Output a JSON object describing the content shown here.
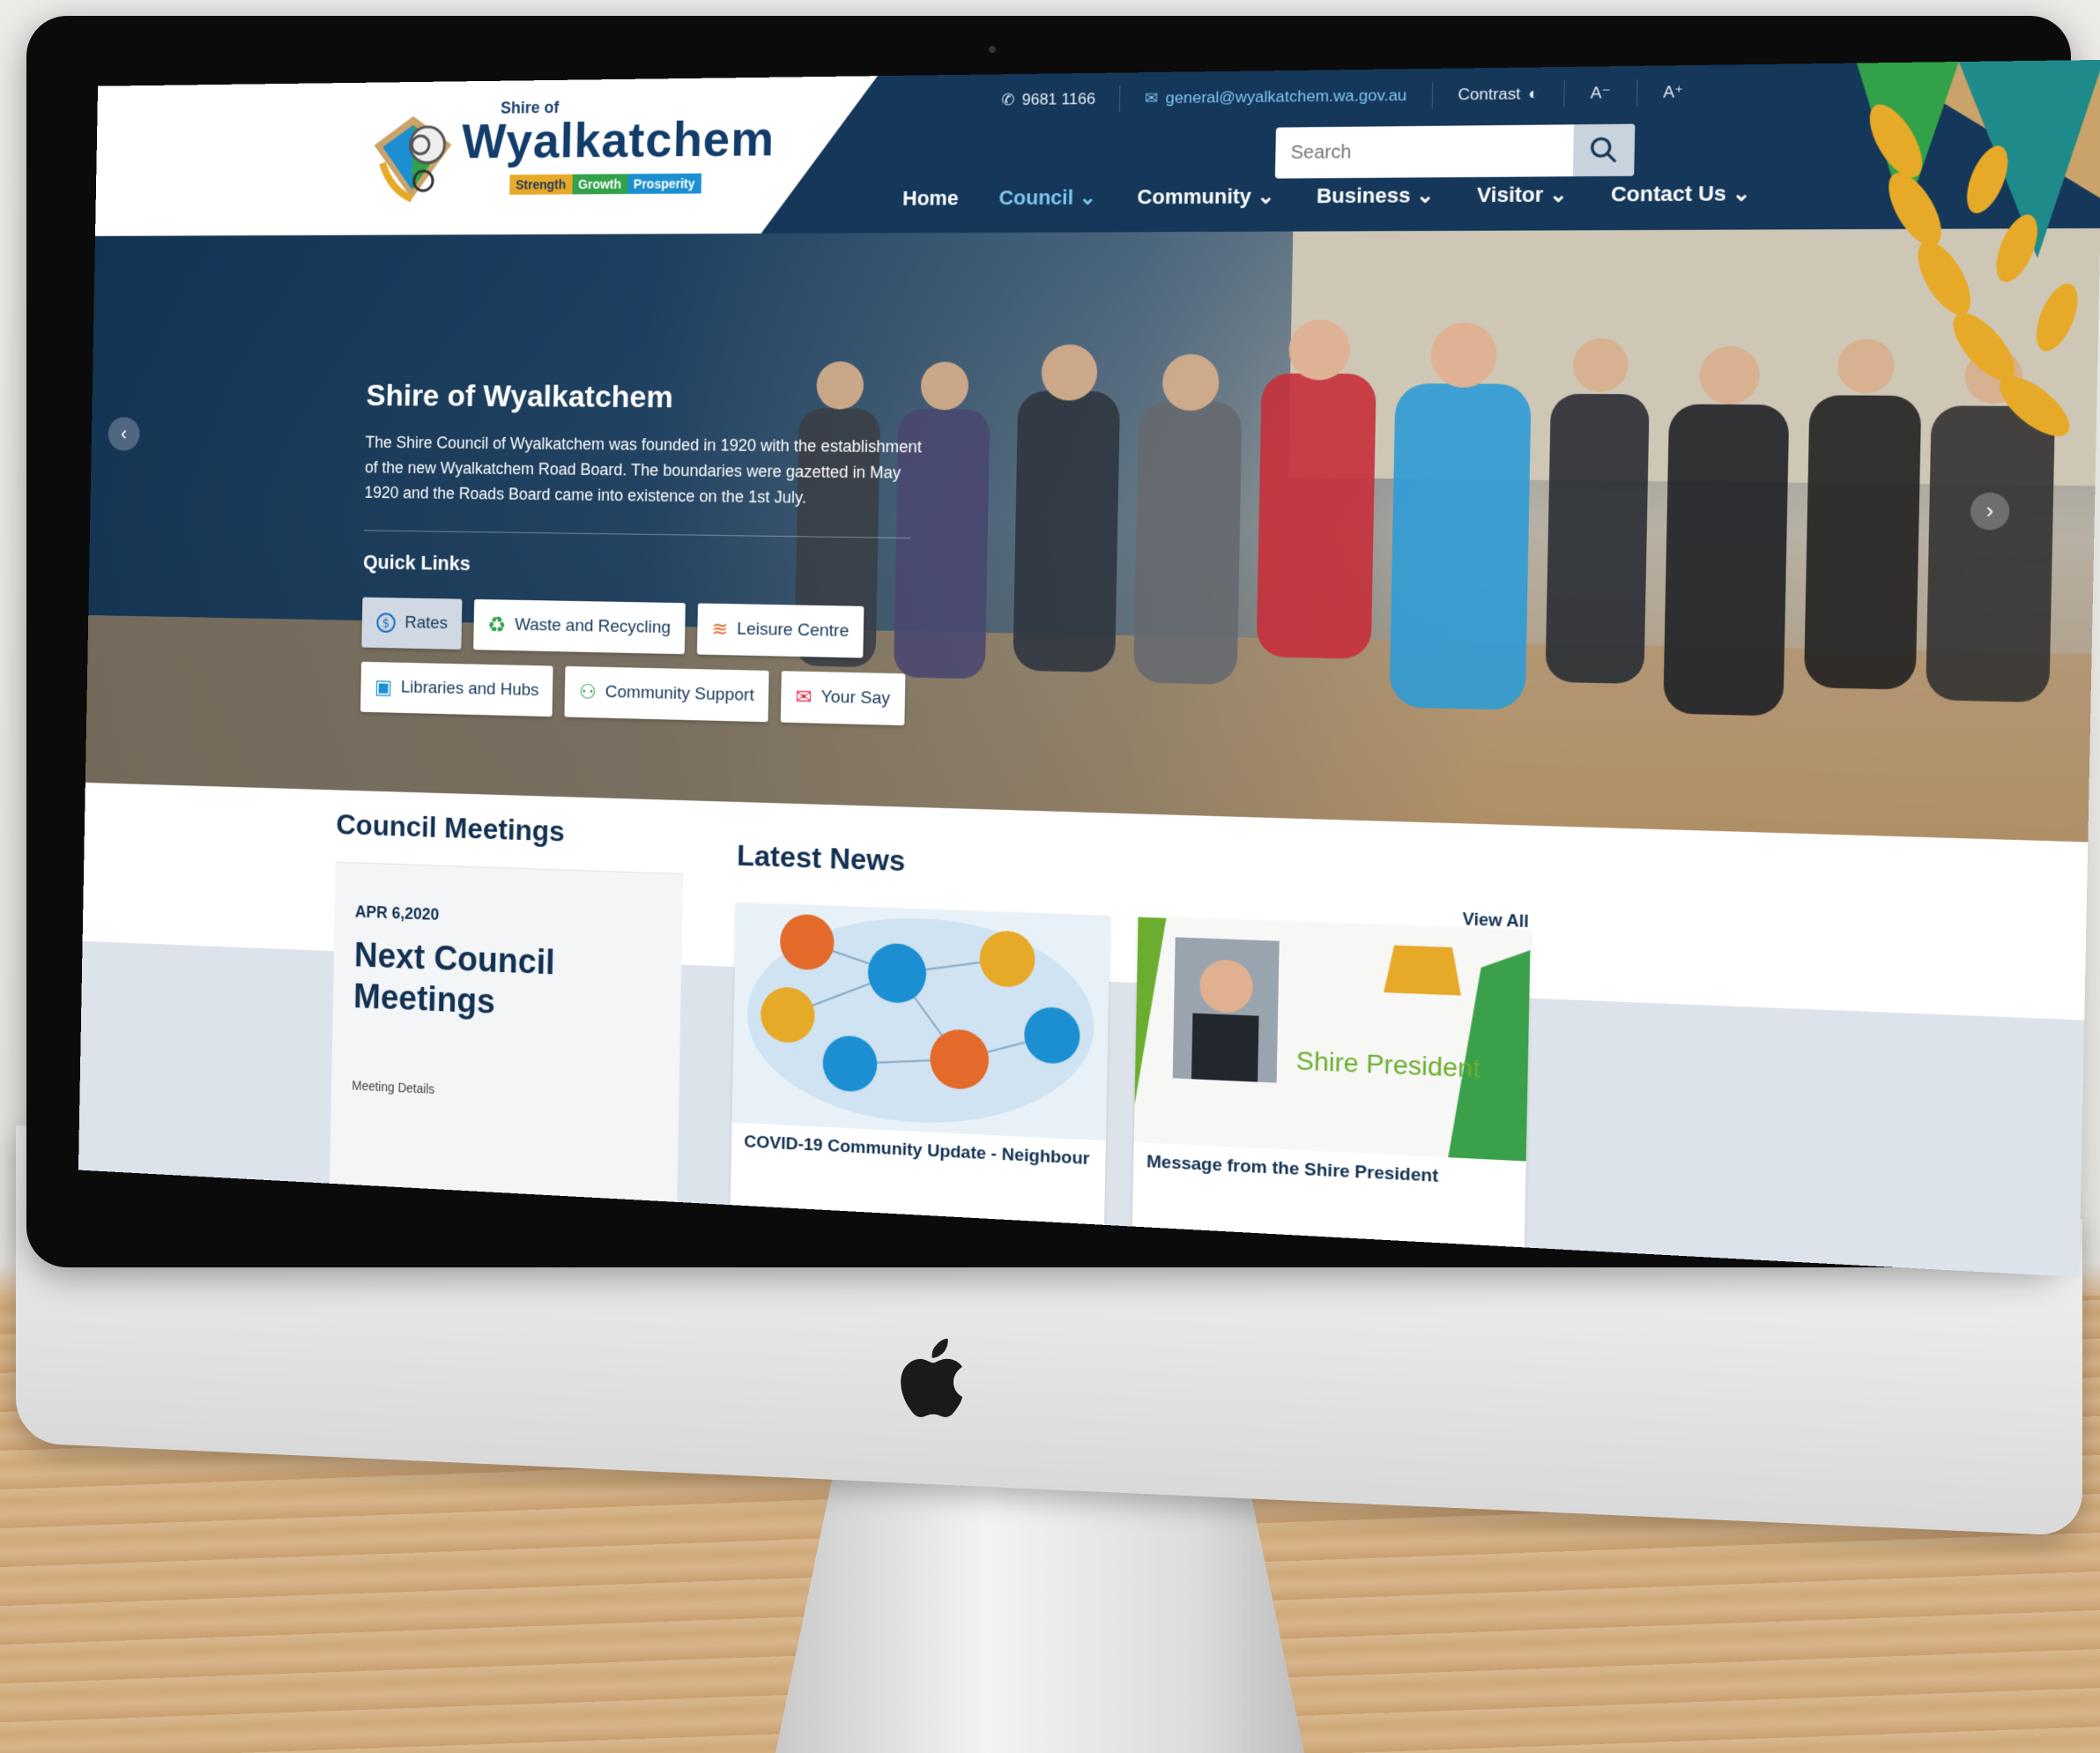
{
  "site": {
    "logo_small": "Shire of",
    "logo_name": "Wyalkatchem",
    "tagline": [
      "Strength",
      "Growth",
      "Prosperity"
    ]
  },
  "topbar": {
    "phone": "9681 1166",
    "email": "general@wyalkatchem.wa.gov.au",
    "contrast_label": "Contrast",
    "font_decrease": "A⁻",
    "font_increase": "A⁺"
  },
  "search": {
    "placeholder": "Search"
  },
  "nav": {
    "items": [
      {
        "label": "Home"
      },
      {
        "label": "Council ⌄"
      },
      {
        "label": "Community ⌄"
      },
      {
        "label": "Business ⌄"
      },
      {
        "label": "Visitor ⌄"
      },
      {
        "label": "Contact Us ⌄"
      }
    ],
    "active_index": 1
  },
  "hero": {
    "title": "Shire of Wyalkatchem",
    "text": "The Shire Council of Wyalkatchem was founded in 1920 with the establishment of the new Wyalkatchem Road Board. The boundaries were gazetted in May 1920 and the Roads Board came into existence on the 1st July.",
    "quick_links_title": "Quick Links",
    "quick_links": [
      {
        "label": "Rates",
        "icon": "dollar-circle-icon"
      },
      {
        "label": "Waste and Recycling",
        "icon": "recycle-icon"
      },
      {
        "label": "Leisure Centre",
        "icon": "swimming-icon"
      },
      {
        "label": "Libraries and Hubs",
        "icon": "library-icon"
      },
      {
        "label": "Community Support",
        "icon": "people-icon"
      },
      {
        "label": "Your Say",
        "icon": "speech-bubble-icon"
      }
    ],
    "prev_arrow": "‹",
    "next_arrow": "›"
  },
  "council_meetings": {
    "title": "Council Meetings",
    "date": "APR 6,2020",
    "heading": "Next Council Meetings",
    "detail": "Meeting Details"
  },
  "latest_news": {
    "title": "Latest News",
    "view_all": "View All",
    "items": [
      {
        "caption": "COVID-19 Community Update - Neighbour"
      },
      {
        "caption": "Message from the Shire President",
        "image_text": "Shire President"
      }
    ]
  },
  "colors": {
    "navy": "#14375a",
    "accent_blue": "#7fc6f0",
    "gold": "#e7a928",
    "green": "#31a14a"
  }
}
